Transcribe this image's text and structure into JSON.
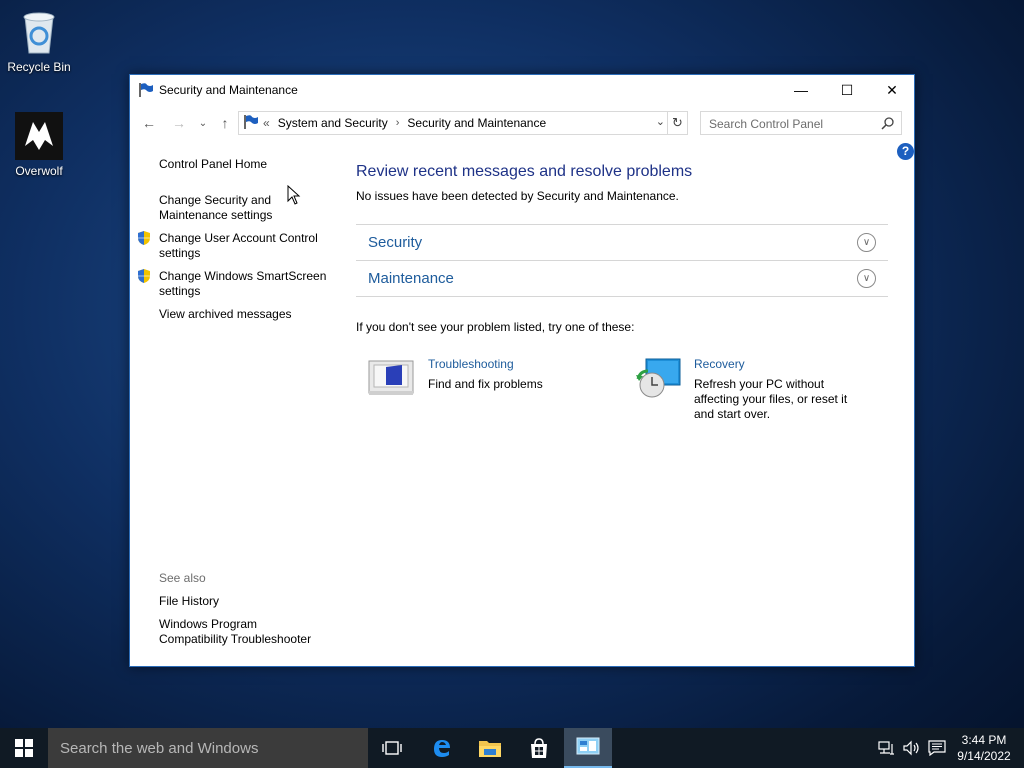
{
  "desktop": {
    "icons": [
      {
        "label": "Recycle Bin"
      },
      {
        "label": "Overwolf"
      }
    ]
  },
  "window": {
    "title": "Security and Maintenance",
    "controls": {
      "minimize": "—",
      "maximize": "☐",
      "close": "✕"
    },
    "address": {
      "overflow": "«",
      "crumbs": [
        "System and Security",
        "Security and Maintenance"
      ],
      "separator": "›"
    },
    "search": {
      "placeholder": "Search Control Panel"
    },
    "help": "?",
    "sidebar": {
      "links": [
        "Control Panel Home",
        "Change Security and Maintenance settings",
        "Change User Account Control settings",
        "Change Windows SmartScreen settings",
        "View archived messages"
      ],
      "see_also_label": "See also",
      "see_also": [
        "File History",
        "Windows Program Compatibility Troubleshooter"
      ]
    },
    "main": {
      "title": "Review recent messages and resolve problems",
      "subtitle": "No issues have been detected by Security and Maintenance.",
      "sections": [
        "Security",
        "Maintenance"
      ],
      "hint": "If you don't see your problem listed, try one of these:",
      "tiles": [
        {
          "link": "Troubleshooting",
          "desc": "Find and fix problems"
        },
        {
          "link": "Recovery",
          "desc": "Refresh your PC without affecting your files, or reset it and start over."
        }
      ]
    }
  },
  "taskbar": {
    "search_placeholder": "Search the web and Windows",
    "time": "3:44 PM",
    "date": "9/14/2022"
  },
  "colors": {
    "link": "#1e5c9c",
    "title": "#1e3287",
    "taskbar": "#101a24",
    "accent": "#76b9ed"
  }
}
